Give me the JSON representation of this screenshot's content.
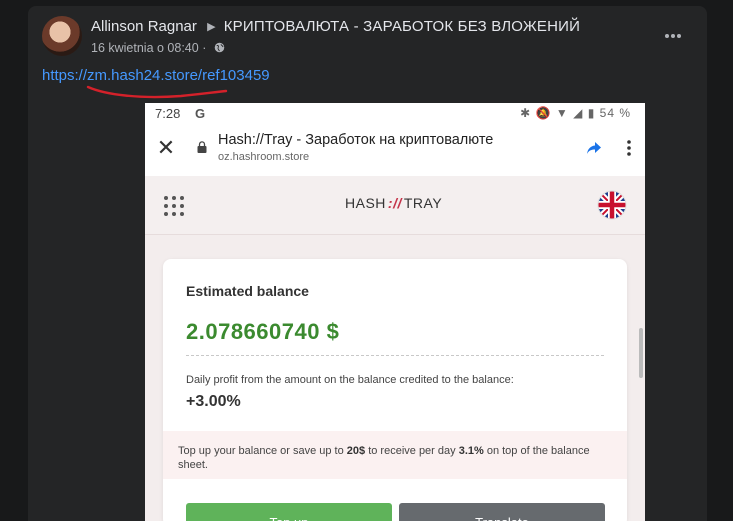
{
  "post": {
    "author": "Allinson Ragnar",
    "group": "КРИПТОВАЛЮТА - ЗАРАБОТОК БЕЗ ВЛОЖЕНИЙ",
    "timestamp": "16 kwietnia o 08:40 ·",
    "link": "https://zm.hash24.store/ref103459"
  },
  "phone": {
    "time": "7:28",
    "g": "G",
    "battery": "54 %",
    "page_title": "Hash://Tray - Заработок на криптовалюте",
    "page_url": "oz.hashroom.store"
  },
  "site": {
    "brand_left": "HASH",
    "brand_sep": "://",
    "brand_right": "TRAY",
    "estimated_balance_label": "Estimated balance",
    "balance": "2.078660740 $",
    "daily_text": "Daily profit from the amount on the balance credited to the balance:",
    "daily_value": "+3.00%",
    "promo_part1": "Top up your balance or save up to ",
    "promo_amount": "20$",
    "promo_part2": " to receive per day ",
    "promo_rate": "3.1%",
    "promo_part3": " on top of the balance sheet.",
    "topup_label": "Top up",
    "translate_label": "Translate"
  },
  "colors": {
    "link": "#4599ff",
    "balance_green": "#3b8a2f",
    "topup_button": "#5fb35a",
    "translate_button": "#666a6e",
    "brand_accent": "#c4344a"
  },
  "icons": [
    "globe-icon",
    "more-icon",
    "lock-icon",
    "share-icon",
    "kebab-icon",
    "grid-icon",
    "uk-flag-icon",
    "close-icon"
  ]
}
